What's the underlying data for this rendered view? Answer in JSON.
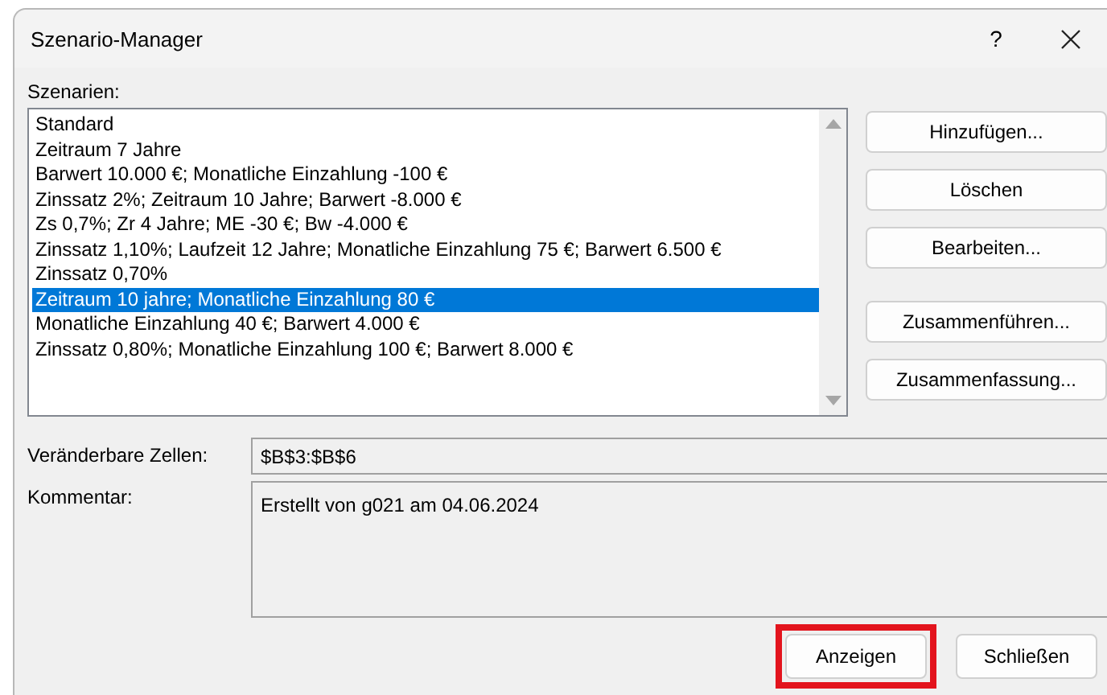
{
  "window": {
    "title": "Szenario-Manager",
    "buttons": [
      {
        "kind": "help",
        "label": "?"
      },
      {
        "kind": "close"
      }
    ]
  },
  "scenarios": {
    "label": "Szenarien:",
    "items": [
      {
        "label": "Standard",
        "selected": false
      },
      {
        "label": "Zeitraum 7 Jahre",
        "selected": false
      },
      {
        "label": "Barwert 10.000 €; Monatliche Einzahlung -100 €",
        "selected": false
      },
      {
        "label": "Zinssatz 2%; Zeitraum 10 Jahre; Barwert -8.000 €",
        "selected": false
      },
      {
        "label": "Zs 0,7%; Zr 4 Jahre; ME -30 €; Bw -4.000 €",
        "selected": false
      },
      {
        "label": "Zinssatz 1,10%; Laufzeit 12 Jahre; Monatliche Einzahlung 75 €; Barwert 6.500 €",
        "selected": false
      },
      {
        "label": "Zinssatz 0,70%",
        "selected": false
      },
      {
        "label": "Zeitraum 10 jahre; Monatliche Einzahlung 80 €",
        "selected": true
      },
      {
        "label": "Monatliche Einzahlung 40 €; Barwert 4.000 €",
        "selected": false
      },
      {
        "label": "Zinssatz 0,80%; Monatliche Einzahlung 100 €; Barwert 8.000 €",
        "selected": false
      }
    ]
  },
  "side_buttons": [
    {
      "label": "Hinzufügen..."
    },
    {
      "label": "Löschen"
    },
    {
      "label": "Bearbeiten..."
    },
    {
      "label": "Zusammenführen..."
    },
    {
      "label": "Zusammenfassung..."
    }
  ],
  "changing_cells": {
    "label": "Veränderbare Zellen:",
    "value": "$B$3:$B$6"
  },
  "comment": {
    "label": "Kommentar:",
    "value": "Erstellt von g021 am 04.06.2024"
  },
  "footer_buttons": [
    {
      "label": "Anzeigen",
      "highlighted": true
    },
    {
      "label": "Schließen",
      "highlighted": false
    }
  ]
}
